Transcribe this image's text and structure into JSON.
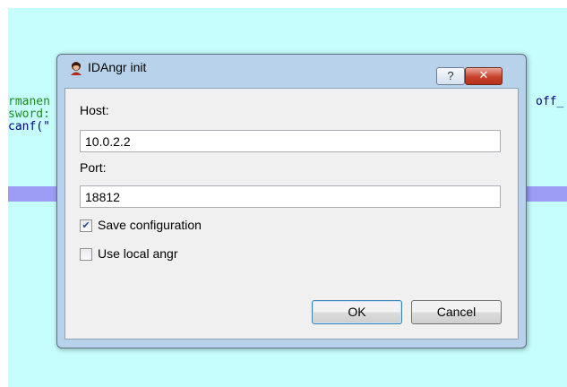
{
  "background_code": {
    "left_lines": [
      "rmanen",
      "sword:",
      "canf(\""
    ],
    "right_lines": [
      "off_"
    ]
  },
  "dialog": {
    "title": "IDAngr init",
    "help_label": "?",
    "close_label": "✕",
    "host_label": "Host:",
    "host_value": "10.0.2.2",
    "port_label": "Port:",
    "port_value": "18812",
    "save_config_label": "Save configuration",
    "save_config_checked": true,
    "use_local_label": "Use local angr",
    "use_local_checked": false,
    "ok_label": "OK",
    "cancel_label": "Cancel"
  },
  "colors": {
    "background": "#c6fdfd",
    "highlight": "#9d9df6",
    "dialog_frame": "#b7d2ea",
    "close_button": "#c8432d"
  }
}
